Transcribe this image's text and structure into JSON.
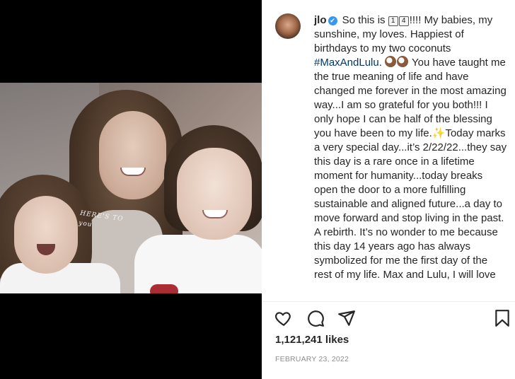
{
  "post": {
    "username": "jlo",
    "verified_badge": "✔",
    "caption_parts": {
      "intro": "So this is ",
      "key1": "1",
      "key2": "4",
      "after_keys": "!!!! My babies, my sunshine, my loves. Happiest of birthdays to my two coconuts ",
      "hashtag": "#MaxAndLulu",
      "after_hashtag": ". ",
      "after_coconuts": " You have taught me the true meaning of life and have changed me forever in the most amazing way...I am so grateful for you both!!! I only hope I can be half of the blessing you have been to my life.",
      "after_sparkle": "Today marks a very special day...it’s 2/22/22...they say this day is a rare once in a lifetime moment for humanity...today breaks open the door to a more fulfilling sustainable and aligned future...a day to move forward and stop living in the past. A rebirth. It’s no wonder to me because this day 14 years ago has always symbolized for me the first day of the rest of my life. Max and Lulu, I will love"
    },
    "likes": "1,121,241 likes",
    "date": "FEBRUARY 23, 2022"
  },
  "media": {
    "overlay_text": "HERE'S TO\nyou"
  },
  "icons": {
    "like": "heart-icon",
    "comment": "comment-icon",
    "share": "share-icon",
    "save": "bookmark-icon",
    "verified": "verified-badge-icon",
    "emoji_coconut": "coconut-emoji",
    "emoji_sparkle": "sparkles-emoji"
  },
  "colors": {
    "hashtag": "#00376b",
    "verified": "#3897f0",
    "text": "#262626",
    "muted": "#8e8e8e"
  }
}
